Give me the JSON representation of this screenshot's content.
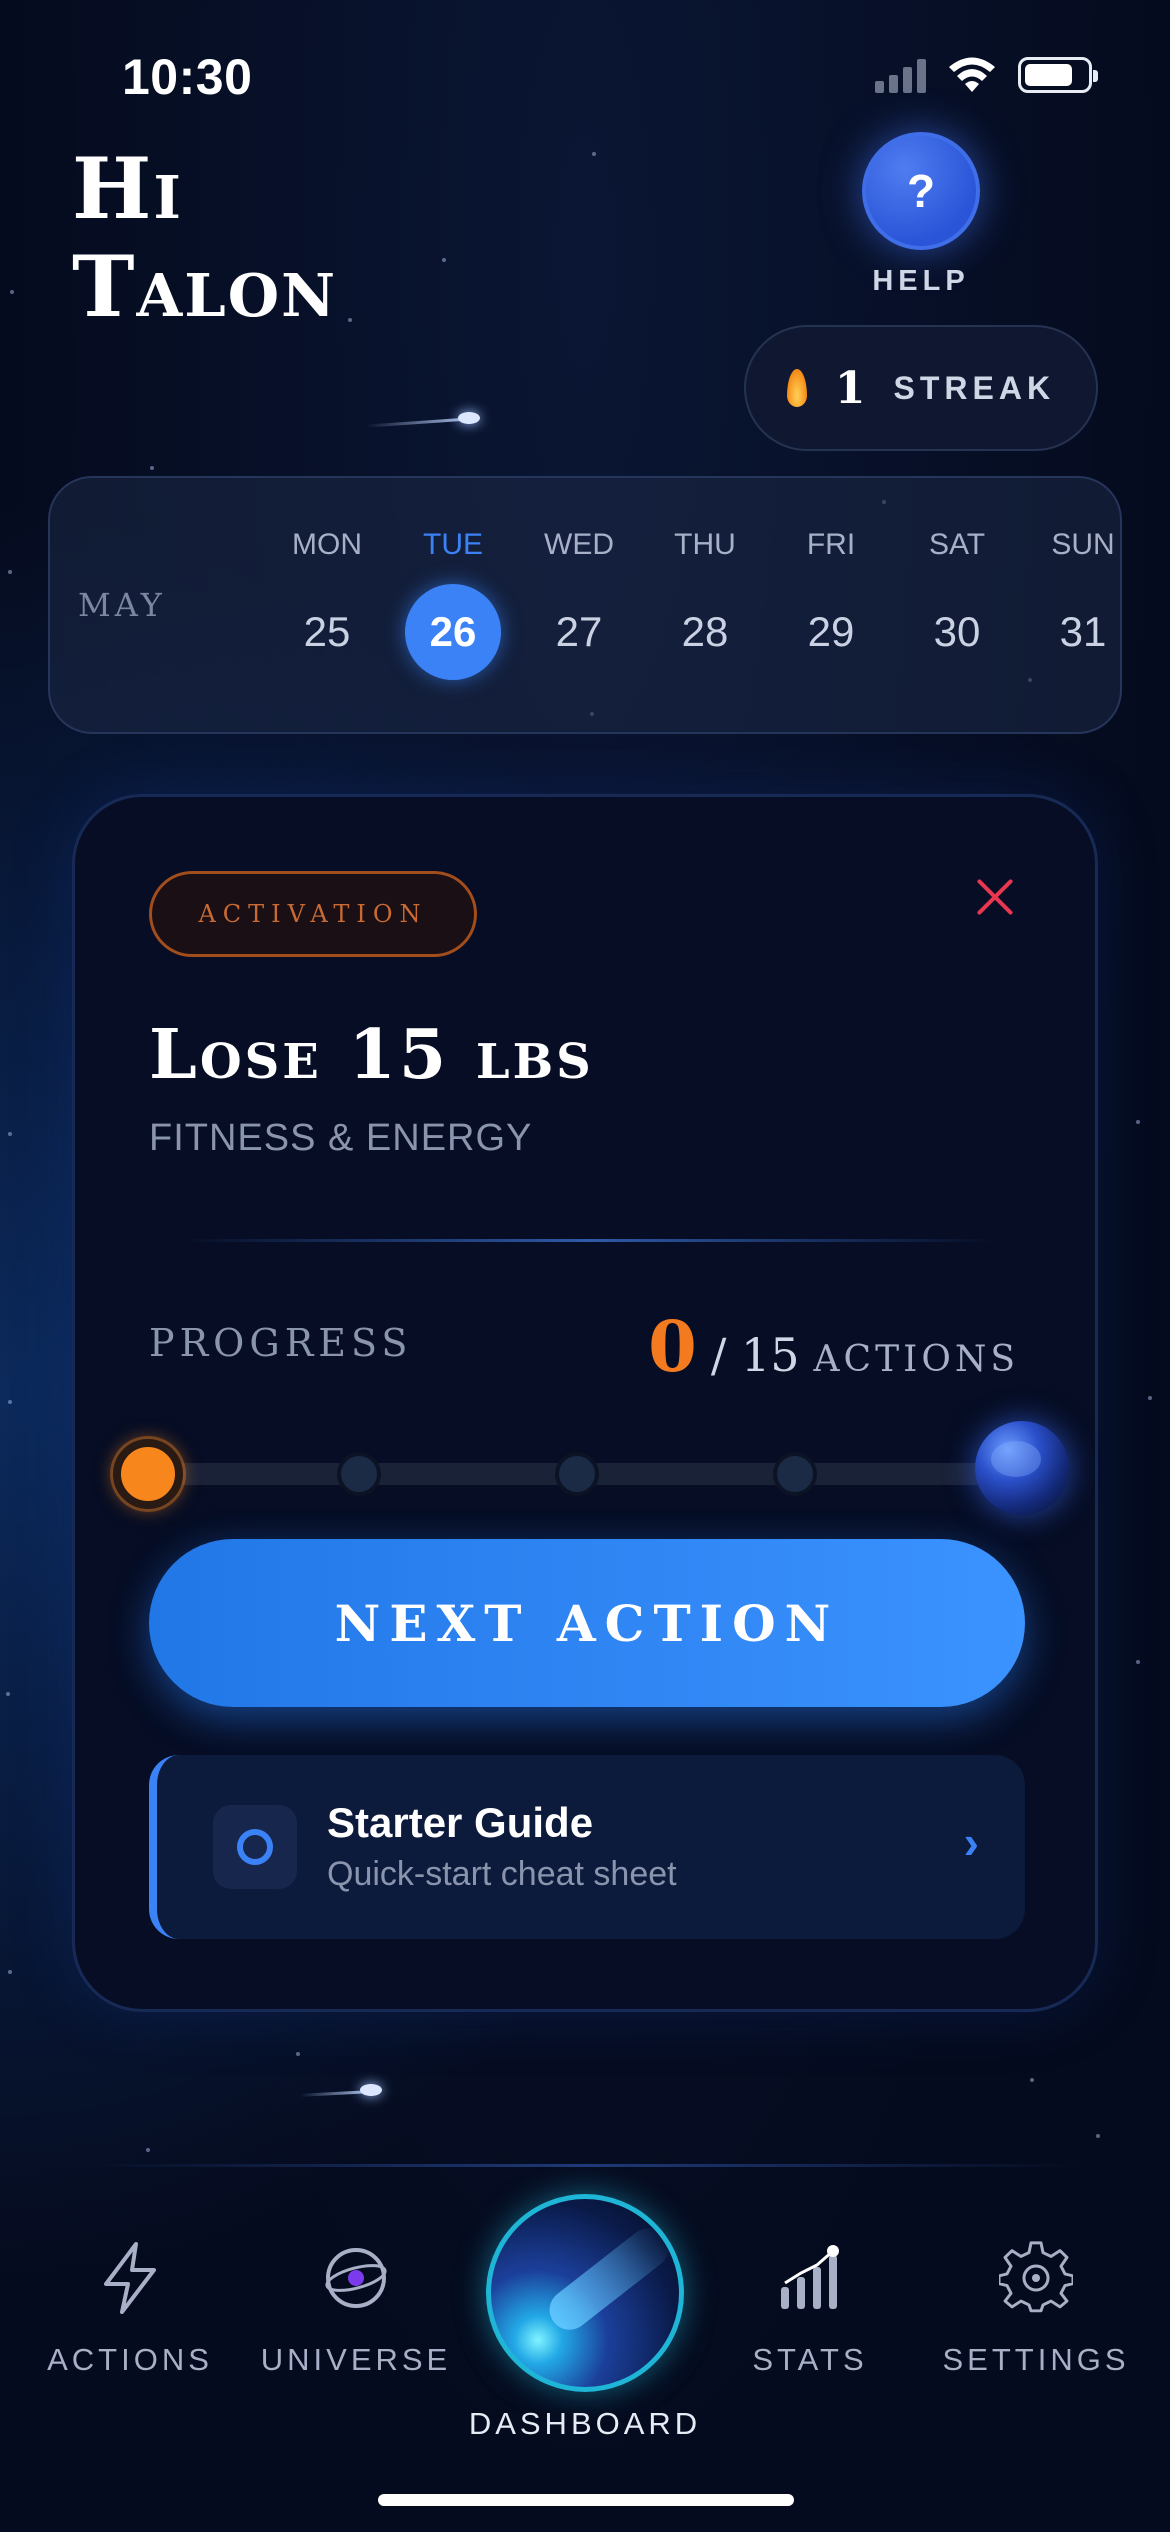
{
  "status_bar": {
    "time": "10:30"
  },
  "header": {
    "greeting_line1": "Hi",
    "greeting_line2": "Talon",
    "help_symbol": "?",
    "help_label": "HELP",
    "streak_icon": "flame-icon",
    "streak_count": "1",
    "streak_label": "STREAK"
  },
  "calendar": {
    "month": "MAY",
    "days": [
      {
        "dow": "MON",
        "num": "25"
      },
      {
        "dow": "TUE",
        "num": "26"
      },
      {
        "dow": "WED",
        "num": "27"
      },
      {
        "dow": "THU",
        "num": "28"
      },
      {
        "dow": "FRI",
        "num": "29"
      },
      {
        "dow": "SAT",
        "num": "30"
      },
      {
        "dow": "SUN",
        "num": "31"
      }
    ],
    "selected_index": 1
  },
  "goal": {
    "badge": "ACTIVATION",
    "title": "Lose 15 lbs",
    "category": "FITNESS & ENERGY",
    "progress_label": "PROGRESS",
    "progress_done": "0",
    "progress_total": "/ 15",
    "progress_unit": "ACTIONS",
    "progress_fraction": 0,
    "next_action_label": "NEXT ACTION",
    "guide_title": "Starter Guide",
    "guide_subtitle": "Quick-start cheat sheet",
    "guide_chevron": "›"
  },
  "tabs": [
    {
      "label": "ACTIONS",
      "icon": "lightning-icon"
    },
    {
      "label": "UNIVERSE",
      "icon": "planet-icon"
    },
    {
      "label": "DASHBOARD",
      "icon": "comet-icon"
    },
    {
      "label": "STATS",
      "icon": "chart-icon"
    },
    {
      "label": "SETTINGS",
      "icon": "gear-icon"
    }
  ],
  "colors": {
    "background": "#050b1e",
    "accent": "#3b82f6",
    "progress_orange": "#f7861d",
    "close_red": "#e8374f"
  }
}
